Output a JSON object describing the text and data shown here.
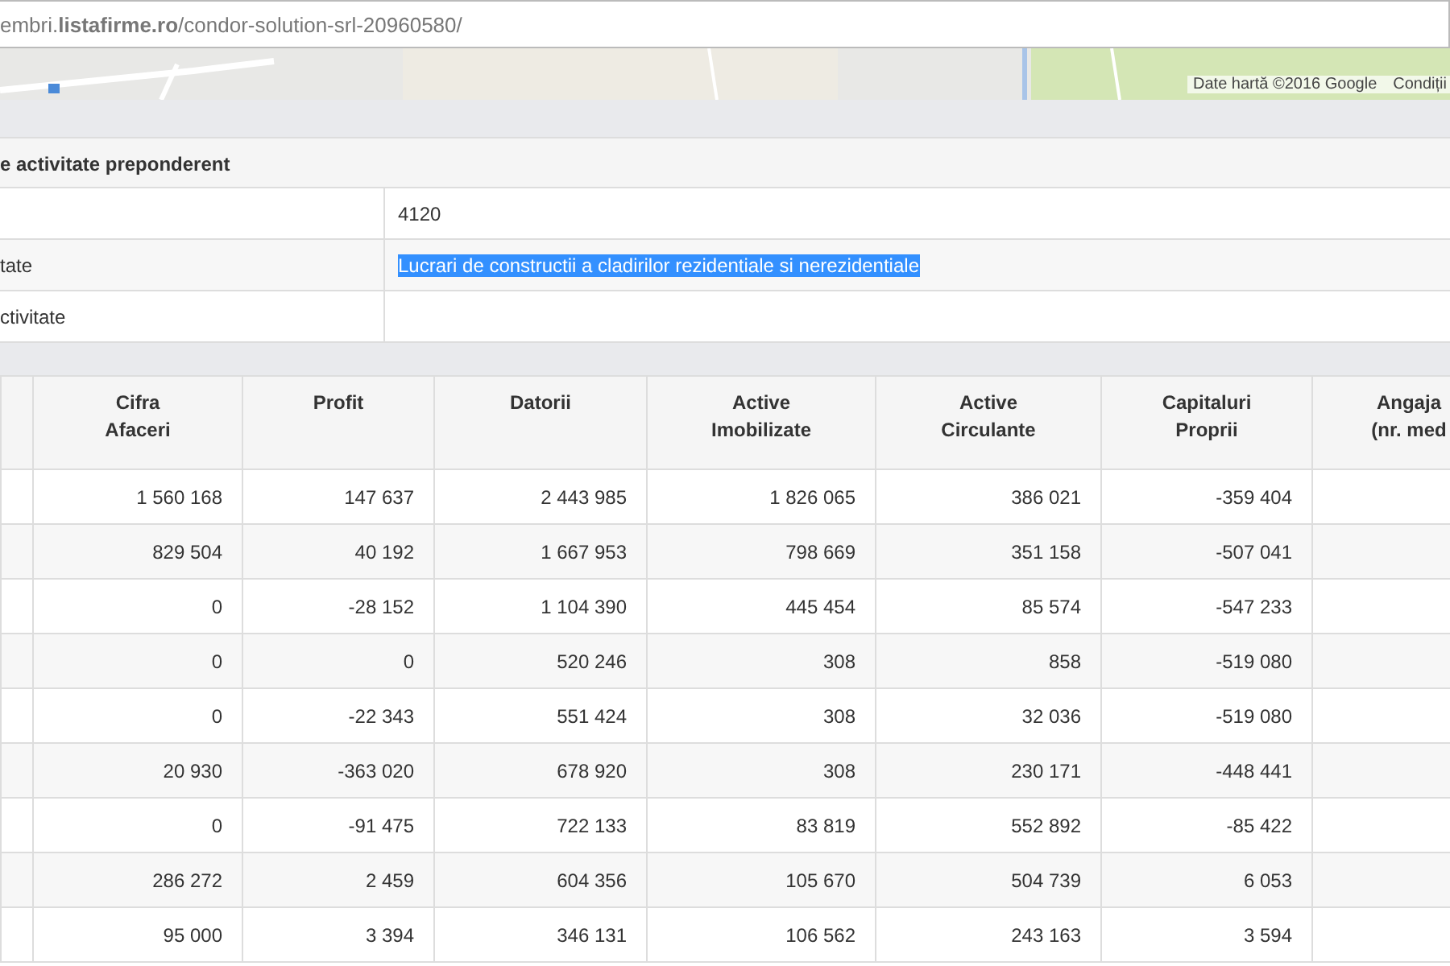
{
  "address_bar": {
    "url": "embri.**listafirme.ro**/condor-solution-srl-20960580/"
  },
  "map": {
    "kind": "picture",
    "attribution": "Date hartă ©2016 Google",
    "terms_link": "Condiții"
  },
  "activity_section": {
    "title": "e activitate preponderent",
    "rows": [
      {
        "label": "",
        "value": "4120",
        "selected": false
      },
      {
        "label": "tate",
        "value": "Lucrari de constructii a cladirilor rezidentiale si nerezidentiale",
        "selected": true
      },
      {
        "label": "ctivitate",
        "value": "",
        "selected": false
      }
    ]
  },
  "financial_table": {
    "columns": [
      "",
      "Cifra\nAfaceri",
      "Profit",
      "Datorii",
      "Active\nImobilizate",
      "Active\nCirculante",
      "Capitaluri\nProprii",
      "Angaja\n(nr. med"
    ],
    "rows": [
      [
        "",
        "1 560 168",
        "147 637",
        "2 443 985",
        "1 826 065",
        "386 021",
        "-359 404",
        ""
      ],
      [
        "",
        "829 504",
        "40 192",
        "1 667 953",
        "798 669",
        "351 158",
        "-507 041",
        ""
      ],
      [
        "",
        "0",
        "-28 152",
        "1 104 390",
        "445 454",
        "85 574",
        "-547 233",
        ""
      ],
      [
        "",
        "0",
        "0",
        "520 246",
        "308",
        "858",
        "-519 080",
        ""
      ],
      [
        "",
        "0",
        "-22 343",
        "551 424",
        "308",
        "32 036",
        "-519 080",
        ""
      ],
      [
        "",
        "20 930",
        "-363 020",
        "678 920",
        "308",
        "230 171",
        "-448 441",
        ""
      ],
      [
        "",
        "0",
        "-91 475",
        "722 133",
        "83 819",
        "552 892",
        "-85 422",
        ""
      ],
      [
        "",
        "286 272",
        "2 459",
        "604 356",
        "105 670",
        "504 739",
        "6 053",
        ""
      ],
      [
        "",
        "95 000",
        "3 394",
        "346 131",
        "106 562",
        "243 163",
        "3 594",
        ""
      ]
    ]
  }
}
